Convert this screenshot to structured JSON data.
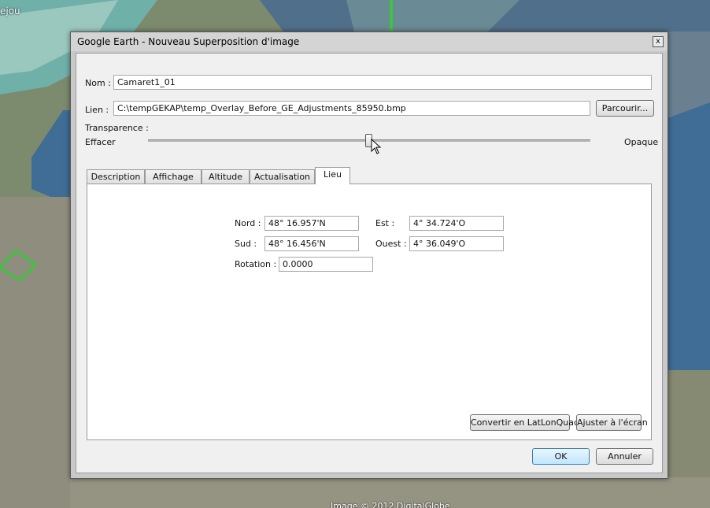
{
  "map": {
    "top_left_label": "ejou",
    "credit": "Image © 2012 DigitalGlobe",
    "colors": {
      "water": "#3f6d95",
      "land": "#8a8f7c",
      "sea_shallow": "#6fb0a9"
    }
  },
  "dialog": {
    "title": "Google Earth - Nouveau Superposition d'image",
    "close_glyph": "x",
    "name_label": "Nom :",
    "name_value": "Camaret1_01",
    "link_label": "Lien :",
    "link_value": "C:\\tempGEKAP\\temp_Overlay_Before_GE_Adjustments_85950.bmp",
    "browse_label": "Parcourir...",
    "transparency_label": "Transparence :",
    "transparency_min_label": "Effacer",
    "transparency_max_label": "Opaque",
    "transparency_level": 0.5,
    "tabs": [
      {
        "label": "Description",
        "active": false
      },
      {
        "label": "Affichage",
        "active": false
      },
      {
        "label": "Altitude",
        "active": false
      },
      {
        "label": "Actualisation",
        "active": false
      },
      {
        "label": "Lieu",
        "active": true
      }
    ],
    "lieu": {
      "north_label": "Nord :",
      "north_value": "48° 16.957'N",
      "east_label": "Est :",
      "east_value": "4° 34.724'O",
      "south_label": "Sud :",
      "south_value": "48° 16.456'N",
      "west_label": "Ouest :",
      "west_value": "4° 36.049'O",
      "rotation_label": "Rotation :",
      "rotation_value": "0.0000",
      "convert_label": "Convertir en LatLonQuad",
      "fit_label": "Ajuster à l'écran"
    },
    "ok_label": "OK",
    "cancel_label": "Annuler"
  }
}
